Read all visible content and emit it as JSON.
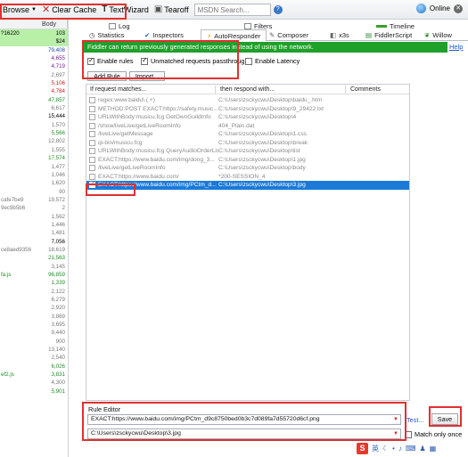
{
  "toolbar": {
    "browse": "Browse",
    "clear_cache": "Clear Cache",
    "text_wizard": "TextWizard",
    "tearoff": "Tearoff",
    "search_placeholder": "MSDN Search...",
    "online": "Online"
  },
  "session_list": {
    "header_body": "Body",
    "rows": [
      {
        "text": "?16220",
        "value": "103",
        "color": "#000000",
        "selected": true
      },
      {
        "text": "",
        "value": "$24",
        "color": "#000000",
        "selected": true
      },
      {
        "text": "",
        "value": "79,408",
        "color": "#1b3fb0",
        "selected": false
      },
      {
        "text": "",
        "value": "4,655",
        "color": "#7d1b9c",
        "selected": false
      },
      {
        "text": "",
        "value": "4,719",
        "color": "#7d1b9c",
        "selected": false
      },
      {
        "text": "",
        "value": "2,697",
        "color": "#777777",
        "selected": false
      },
      {
        "text": "",
        "value": "5,106",
        "color": "#d01b1b",
        "selected": false
      },
      {
        "text": "",
        "value": "4,784",
        "color": "#d01b1b",
        "selected": false
      },
      {
        "text": "",
        "value": "47,857",
        "color": "#1e8f22",
        "selected": false
      },
      {
        "text": "",
        "value": "6,617",
        "color": "#777777",
        "selected": false
      },
      {
        "text": "",
        "value": "15,444",
        "color": "#000000",
        "selected": false
      },
      {
        "text": "",
        "value": "1,570",
        "color": "#777777",
        "selected": false
      },
      {
        "text": "",
        "value": "5,566",
        "color": "#1e8f22",
        "selected": false
      },
      {
        "text": "",
        "value": "12,802",
        "color": "#777777",
        "selected": false
      },
      {
        "text": "",
        "value": "1,555",
        "color": "#777777",
        "selected": false
      },
      {
        "text": "",
        "value": "17,574",
        "color": "#1e8f22",
        "selected": false
      },
      {
        "text": "",
        "value": "1,477",
        "color": "#777777",
        "selected": false
      },
      {
        "text": "",
        "value": "1,046",
        "color": "#777777",
        "selected": false
      },
      {
        "text": "",
        "value": "1,620",
        "color": "#777777",
        "selected": false
      },
      {
        "text": "",
        "value": "90",
        "color": "#777777",
        "selected": false
      },
      {
        "text": "cafe7be9",
        "value": "19,572",
        "color": "#777777",
        "selected": false
      },
      {
        "text": "9ec9b5b6",
        "value": "2",
        "color": "#777777",
        "selected": false
      },
      {
        "text": "",
        "value": "1,562",
        "color": "#777777",
        "selected": false
      },
      {
        "text": "",
        "value": "1,446",
        "color": "#777777",
        "selected": false
      },
      {
        "text": "",
        "value": "1,481",
        "color": "#777777",
        "selected": false
      },
      {
        "text": "",
        "value": "7,056",
        "color": "#000000",
        "selected": false
      },
      {
        "text": "ce8aed9356",
        "value": "18,619",
        "color": "#777777",
        "selected": false
      },
      {
        "text": "",
        "value": "21,563",
        "color": "#1e8f22",
        "selected": false
      },
      {
        "text": "",
        "value": "3,145",
        "color": "#777777",
        "selected": false
      },
      {
        "text": "fa.js",
        "value": "96,859",
        "color": "#1e8f22",
        "selected": false
      },
      {
        "text": "",
        "value": "1,339",
        "color": "#1e8f22",
        "selected": false
      },
      {
        "text": "",
        "value": "2,122",
        "color": "#777777",
        "selected": false
      },
      {
        "text": "",
        "value": "6,279",
        "color": "#777777",
        "selected": false
      },
      {
        "text": "",
        "value": "2,920",
        "color": "#777777",
        "selected": false
      },
      {
        "text": "",
        "value": "3,869",
        "color": "#777777",
        "selected": false
      },
      {
        "text": "",
        "value": "3,695",
        "color": "#777777",
        "selected": false
      },
      {
        "text": "",
        "value": "9,440",
        "color": "#777777",
        "selected": false
      },
      {
        "text": "",
        "value": "900",
        "color": "#777777",
        "selected": false
      },
      {
        "text": "",
        "value": "13,140",
        "color": "#777777",
        "selected": false
      },
      {
        "text": "",
        "value": "2,540",
        "color": "#777777",
        "selected": false
      },
      {
        "text": "",
        "value": "6,026",
        "color": "#1e8f22",
        "selected": false
      },
      {
        "text": "ef2.js",
        "value": "3,831",
        "color": "#1e8f22",
        "selected": false
      },
      {
        "text": "",
        "value": "4,300",
        "color": "#777777",
        "selected": false
      },
      {
        "text": "",
        "value": "5,901",
        "color": "#1e8f22",
        "selected": false
      }
    ]
  },
  "tabs_row1": {
    "log": "Log",
    "filters": "Filters",
    "timeline": "Timeline"
  },
  "tabs_row2": {
    "statistics": "Statistics",
    "inspectors": "Inspectors",
    "autoresponder": "AutoResponder",
    "composer": "Composer",
    "fiddlerscript": "FiddlerScript",
    "willow": "Willow"
  },
  "autoresponder": {
    "banner": "Fiddler can return previously generated responses instead of using the network.",
    "help": "Help",
    "enable_rules": {
      "label": "Enable rules",
      "checked": true
    },
    "unmatched_passthrough": {
      "label": "Unmatched requests passthrough",
      "checked": true
    },
    "enable_latency": {
      "label": "Enable Latency",
      "checked": false
    },
    "add_rule": "Add Rule",
    "import": "Import...",
    "columns": {
      "match": "If request matches...",
      "respond": "then respond with...",
      "comments": "Comments"
    },
    "rules": [
      {
        "match": "regex:www.baidu\\.(.+)",
        "respond": "C:\\Users\\zsckycwu\\Desktop\\baidu_.htm",
        "enabled": false,
        "selected": false
      },
      {
        "match": "METHOD:POST EXACT:https://safety.music...",
        "respond": "C:\\Users\\zsckycwu\\Desktop\\9_29422.txt",
        "enabled": false,
        "selected": false
      },
      {
        "match": "URLWithBody:musicu.fcg GetOwnGuildInfo",
        "respond": "C:\\Users\\zsckycwu\\Desktop\\4",
        "enabled": false,
        "selected": false
      },
      {
        "match": "/show/liveLive/getLiveRoomInfo",
        "respond": "404_Plain.dat",
        "enabled": false,
        "selected": false
      },
      {
        "match": "/liveLive/getMessage",
        "respond": "C:\\Users\\zsckycwu\\Desktop\\1.css",
        "enabled": false,
        "selected": false
      },
      {
        "match": "qi-bin/musicu.fcg",
        "respond": "C:\\Users\\zsckycwu\\Desktop\\break",
        "enabled": false,
        "selected": false
      },
      {
        "match": "URLWithBody:musicu.fcg QueryAudioOrderList",
        "respond": "C:\\Users\\zsckycwu\\Desktop\\list",
        "enabled": false,
        "selected": false
      },
      {
        "match": "EXACT:https://www.baidu.com/img/dong_3...",
        "respond": "C:\\Users\\zsckycwu\\Desktop\\1.jpg",
        "enabled": false,
        "selected": false
      },
      {
        "match": "/liveLive/getLiveRoomInfo",
        "respond": "C:\\Users\\zsckycwu\\Desktop\\body",
        "enabled": false,
        "selected": false
      },
      {
        "match": "EXACT:https://www.baidu.com/",
        "respond": "*200-SESSION_4",
        "enabled": false,
        "selected": false
      },
      {
        "match": "EXACT:https://www.baidu.com/img/PCtm_d...",
        "respond": "C:\\Users\\zsckycwu\\Desktop\\3.jpg",
        "enabled": true,
        "selected": true
      }
    ],
    "rule_editor": {
      "label": "Rule Editor",
      "match_value": "EXACT:https://www.baidu.com/img/PCtm_d9c8750bed0b3c7d089fa7d55720d6cf.png",
      "respond_value": "C:\\Users\\zsckycwu\\Desktop\\3.jpg",
      "test": "Test...",
      "save": "Save",
      "match_only_once": {
        "label": "Match only once",
        "checked": false
      }
    }
  },
  "tray": {
    "lang": "英",
    "icons": [
      "moon-icon",
      "dot-icon",
      "mic-icon",
      "keyboard-icon",
      "shirt-icon",
      "grid-icon"
    ]
  },
  "colors": {
    "banner_green": "#1fa02a",
    "selection_blue": "#1b7ad8",
    "highlight_red": "#e03030",
    "session_selected": "#b8f0a8"
  }
}
